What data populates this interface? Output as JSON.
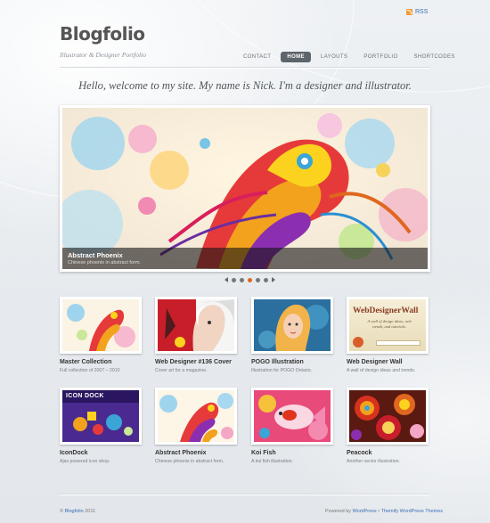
{
  "header": {
    "rss": "RSS",
    "logo": "Blogfolio",
    "tagline": "Illustrator & Designer Portfolio"
  },
  "nav": {
    "items": [
      {
        "label": "CONTACT"
      },
      {
        "label": "HOME",
        "active": true
      },
      {
        "label": "LAYOUTS"
      },
      {
        "label": "PORTFOLIO"
      },
      {
        "label": "SHORTCODES"
      }
    ]
  },
  "welcome": "Hello, welcome to my site. My name is Nick. I'm a designer and illustrator.",
  "slider": {
    "title": "Abstract Phoenix",
    "subtitle": "Chinese phoenix in abstract form.",
    "dots": 5,
    "active_dot": 2
  },
  "portfolio": [
    {
      "title": "Master Collection",
      "desc": "Full collection of 2007 – 2010"
    },
    {
      "title": "Web Designer #136 Cover",
      "desc": "Cover art for a magazine."
    },
    {
      "title": "POGO Illustration",
      "desc": "Illustration for POGO Ontario."
    },
    {
      "title": "Web Designer Wall",
      "desc": "A wall of design ideas and trends.",
      "thumb_title": "WebDesignerWall",
      "thumb_sub": "A wall of design ideas, web trends, and tutorials."
    },
    {
      "title": "IconDock",
      "desc": "Ajax powered icon shop.",
      "thumb_title": "ICON DOCK"
    },
    {
      "title": "Abstract Phoenix",
      "desc": "Chinese phoenix in abstract form."
    },
    {
      "title": "Koi Fish",
      "desc": "A koi fish illustration."
    },
    {
      "title": "Peacock",
      "desc": "Another vector illustration."
    }
  ],
  "footer": {
    "copyright_prefix": "© ",
    "site_link": "Blogfolio",
    "year": " 2011",
    "powered_prefix": "Powered by ",
    "wordpress_link": "WordPress",
    "separator": " • ",
    "themify_link": "Themify WordPress Themes"
  },
  "colors": {
    "accent": "#e0671f",
    "link": "#3b6fb6",
    "nav_active": "#5e646b"
  }
}
